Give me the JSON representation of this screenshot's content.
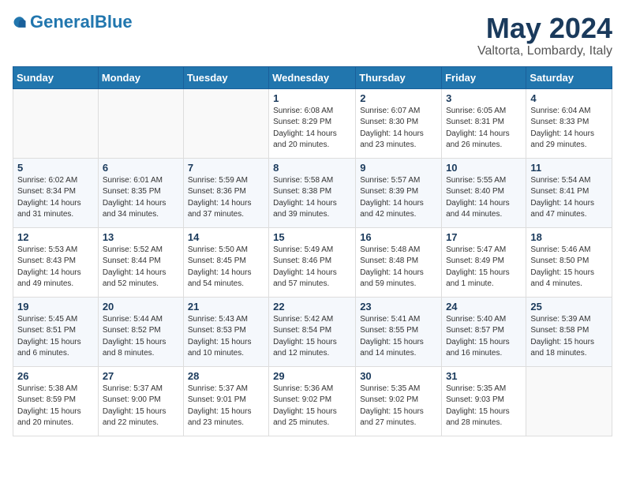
{
  "header": {
    "logo_general": "General",
    "logo_blue": "Blue",
    "month_title": "May 2024",
    "location": "Valtorta, Lombardy, Italy"
  },
  "days_of_week": [
    "Sunday",
    "Monday",
    "Tuesday",
    "Wednesday",
    "Thursday",
    "Friday",
    "Saturday"
  ],
  "weeks": [
    [
      {
        "day": "",
        "info": ""
      },
      {
        "day": "",
        "info": ""
      },
      {
        "day": "",
        "info": ""
      },
      {
        "day": "1",
        "info": "Sunrise: 6:08 AM\nSunset: 8:29 PM\nDaylight: 14 hours\nand 20 minutes."
      },
      {
        "day": "2",
        "info": "Sunrise: 6:07 AM\nSunset: 8:30 PM\nDaylight: 14 hours\nand 23 minutes."
      },
      {
        "day": "3",
        "info": "Sunrise: 6:05 AM\nSunset: 8:31 PM\nDaylight: 14 hours\nand 26 minutes."
      },
      {
        "day": "4",
        "info": "Sunrise: 6:04 AM\nSunset: 8:33 PM\nDaylight: 14 hours\nand 29 minutes."
      }
    ],
    [
      {
        "day": "5",
        "info": "Sunrise: 6:02 AM\nSunset: 8:34 PM\nDaylight: 14 hours\nand 31 minutes."
      },
      {
        "day": "6",
        "info": "Sunrise: 6:01 AM\nSunset: 8:35 PM\nDaylight: 14 hours\nand 34 minutes."
      },
      {
        "day": "7",
        "info": "Sunrise: 5:59 AM\nSunset: 8:36 PM\nDaylight: 14 hours\nand 37 minutes."
      },
      {
        "day": "8",
        "info": "Sunrise: 5:58 AM\nSunset: 8:38 PM\nDaylight: 14 hours\nand 39 minutes."
      },
      {
        "day": "9",
        "info": "Sunrise: 5:57 AM\nSunset: 8:39 PM\nDaylight: 14 hours\nand 42 minutes."
      },
      {
        "day": "10",
        "info": "Sunrise: 5:55 AM\nSunset: 8:40 PM\nDaylight: 14 hours\nand 44 minutes."
      },
      {
        "day": "11",
        "info": "Sunrise: 5:54 AM\nSunset: 8:41 PM\nDaylight: 14 hours\nand 47 minutes."
      }
    ],
    [
      {
        "day": "12",
        "info": "Sunrise: 5:53 AM\nSunset: 8:43 PM\nDaylight: 14 hours\nand 49 minutes."
      },
      {
        "day": "13",
        "info": "Sunrise: 5:52 AM\nSunset: 8:44 PM\nDaylight: 14 hours\nand 52 minutes."
      },
      {
        "day": "14",
        "info": "Sunrise: 5:50 AM\nSunset: 8:45 PM\nDaylight: 14 hours\nand 54 minutes."
      },
      {
        "day": "15",
        "info": "Sunrise: 5:49 AM\nSunset: 8:46 PM\nDaylight: 14 hours\nand 57 minutes."
      },
      {
        "day": "16",
        "info": "Sunrise: 5:48 AM\nSunset: 8:48 PM\nDaylight: 14 hours\nand 59 minutes."
      },
      {
        "day": "17",
        "info": "Sunrise: 5:47 AM\nSunset: 8:49 PM\nDaylight: 15 hours\nand 1 minute."
      },
      {
        "day": "18",
        "info": "Sunrise: 5:46 AM\nSunset: 8:50 PM\nDaylight: 15 hours\nand 4 minutes."
      }
    ],
    [
      {
        "day": "19",
        "info": "Sunrise: 5:45 AM\nSunset: 8:51 PM\nDaylight: 15 hours\nand 6 minutes."
      },
      {
        "day": "20",
        "info": "Sunrise: 5:44 AM\nSunset: 8:52 PM\nDaylight: 15 hours\nand 8 minutes."
      },
      {
        "day": "21",
        "info": "Sunrise: 5:43 AM\nSunset: 8:53 PM\nDaylight: 15 hours\nand 10 minutes."
      },
      {
        "day": "22",
        "info": "Sunrise: 5:42 AM\nSunset: 8:54 PM\nDaylight: 15 hours\nand 12 minutes."
      },
      {
        "day": "23",
        "info": "Sunrise: 5:41 AM\nSunset: 8:55 PM\nDaylight: 15 hours\nand 14 minutes."
      },
      {
        "day": "24",
        "info": "Sunrise: 5:40 AM\nSunset: 8:57 PM\nDaylight: 15 hours\nand 16 minutes."
      },
      {
        "day": "25",
        "info": "Sunrise: 5:39 AM\nSunset: 8:58 PM\nDaylight: 15 hours\nand 18 minutes."
      }
    ],
    [
      {
        "day": "26",
        "info": "Sunrise: 5:38 AM\nSunset: 8:59 PM\nDaylight: 15 hours\nand 20 minutes."
      },
      {
        "day": "27",
        "info": "Sunrise: 5:37 AM\nSunset: 9:00 PM\nDaylight: 15 hours\nand 22 minutes."
      },
      {
        "day": "28",
        "info": "Sunrise: 5:37 AM\nSunset: 9:01 PM\nDaylight: 15 hours\nand 23 minutes."
      },
      {
        "day": "29",
        "info": "Sunrise: 5:36 AM\nSunset: 9:02 PM\nDaylight: 15 hours\nand 25 minutes."
      },
      {
        "day": "30",
        "info": "Sunrise: 5:35 AM\nSunset: 9:02 PM\nDaylight: 15 hours\nand 27 minutes."
      },
      {
        "day": "31",
        "info": "Sunrise: 5:35 AM\nSunset: 9:03 PM\nDaylight: 15 hours\nand 28 minutes."
      },
      {
        "day": "",
        "info": ""
      }
    ]
  ]
}
